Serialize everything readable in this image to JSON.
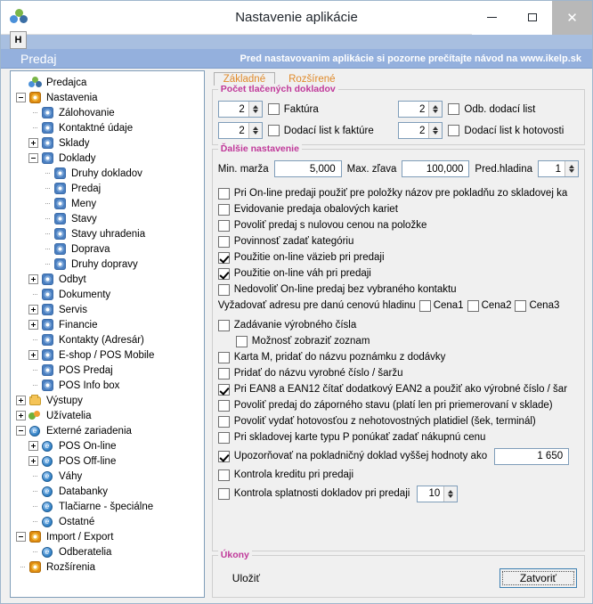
{
  "window": {
    "title": "Nastavenie aplikácie",
    "icon": "app-logo-icon",
    "minimize_label": "–",
    "maximize_label": "□",
    "close_label": "✕"
  },
  "menu": {
    "item_h": "H"
  },
  "banner": {
    "title": "Predaj",
    "note": "Pred nastavovanim aplikácie si pozorne prečítajte návod na www.ikelp.sk"
  },
  "tree": {
    "items": [
      {
        "label": "Predajca",
        "depth": 0,
        "expander": "none",
        "icon": "logo"
      },
      {
        "label": "Nastavenia",
        "depth": 0,
        "expander": "minus",
        "icon": "gear-orange"
      },
      {
        "label": "Zálohovanie",
        "depth": 1,
        "expander": "dots",
        "icon": "gear-blue"
      },
      {
        "label": "Kontaktné údaje",
        "depth": 1,
        "expander": "dots",
        "icon": "gear-blue"
      },
      {
        "label": "Sklady",
        "depth": 1,
        "expander": "plus",
        "icon": "gear-blue"
      },
      {
        "label": "Doklady",
        "depth": 1,
        "expander": "minus",
        "icon": "gear-blue"
      },
      {
        "label": "Druhy dokladov",
        "depth": 2,
        "expander": "dots",
        "icon": "gear-blue"
      },
      {
        "label": "Predaj",
        "depth": 2,
        "expander": "dots",
        "icon": "gear-blue"
      },
      {
        "label": "Meny",
        "depth": 2,
        "expander": "dots",
        "icon": "gear-blue"
      },
      {
        "label": "Stavy",
        "depth": 2,
        "expander": "dots",
        "icon": "gear-blue"
      },
      {
        "label": "Stavy uhradenia",
        "depth": 2,
        "expander": "dots",
        "icon": "gear-blue"
      },
      {
        "label": "Doprava",
        "depth": 2,
        "expander": "dots",
        "icon": "gear-blue"
      },
      {
        "label": "Druhy dopravy",
        "depth": 2,
        "expander": "dots",
        "icon": "gear-blue"
      },
      {
        "label": "Odbyt",
        "depth": 1,
        "expander": "plus",
        "icon": "gear-blue"
      },
      {
        "label": "Dokumenty",
        "depth": 1,
        "expander": "dots",
        "icon": "gear-blue"
      },
      {
        "label": "Servis",
        "depth": 1,
        "expander": "plus",
        "icon": "gear-blue"
      },
      {
        "label": "Financie",
        "depth": 1,
        "expander": "plus",
        "icon": "gear-blue"
      },
      {
        "label": "Kontakty (Adresár)",
        "depth": 1,
        "expander": "dots",
        "icon": "gear-blue"
      },
      {
        "label": "E-shop / POS Mobile",
        "depth": 1,
        "expander": "plus",
        "icon": "gear-blue"
      },
      {
        "label": "POS Predaj",
        "depth": 1,
        "expander": "dots",
        "icon": "gear-blue"
      },
      {
        "label": "POS Info box",
        "depth": 1,
        "expander": "dots",
        "icon": "gear-blue"
      },
      {
        "label": "Výstupy",
        "depth": 0,
        "expander": "plus",
        "icon": "folder"
      },
      {
        "label": "Užívatelia",
        "depth": 0,
        "expander": "plus",
        "icon": "users"
      },
      {
        "label": "Externé zariadenia",
        "depth": 0,
        "expander": "minus",
        "icon": "circle-e"
      },
      {
        "label": "POS On-line",
        "depth": 1,
        "expander": "plus",
        "icon": "circle-e"
      },
      {
        "label": "POS Off-line",
        "depth": 1,
        "expander": "plus",
        "icon": "circle-e"
      },
      {
        "label": "Váhy",
        "depth": 1,
        "expander": "dots",
        "icon": "circle-e"
      },
      {
        "label": "Databanky",
        "depth": 1,
        "expander": "dots",
        "icon": "circle-e"
      },
      {
        "label": "Tlačiarne - špeciálne",
        "depth": 1,
        "expander": "dots",
        "icon": "circle-e"
      },
      {
        "label": "Ostatné",
        "depth": 1,
        "expander": "dots",
        "icon": "circle-e"
      },
      {
        "label": "Import / Export",
        "depth": 0,
        "expander": "minus",
        "icon": "gear-orange"
      },
      {
        "label": "Odberatelia",
        "depth": 1,
        "expander": "dots",
        "icon": "circle-e"
      },
      {
        "label": "Rozšírenia",
        "depth": 0,
        "expander": "dots",
        "icon": "gear-orange"
      }
    ]
  },
  "tabs": [
    {
      "label": "Základné",
      "active": true
    },
    {
      "label": "Rozšírené",
      "active": false
    }
  ],
  "print_group": {
    "title": "Počet tlačených dokladov",
    "fields": [
      {
        "value": "2",
        "label": "Faktúra",
        "checked": false
      },
      {
        "value": "2",
        "label": "Odb. dodací list",
        "checked": false
      },
      {
        "value": "2",
        "label": "Dodací list k faktúre",
        "checked": false
      },
      {
        "value": "2",
        "label": "Dodací list k hotovosti",
        "checked": false
      }
    ]
  },
  "other_group": {
    "title": "Ďalšie nastavenie",
    "min_margin_label": "Min. marža",
    "min_margin_value": "5,000",
    "max_discount_label": "Max. zľava",
    "max_discount_value": "100,000",
    "price_level_label": "Pred.hladina",
    "price_level_value": "1",
    "checkboxes": [
      {
        "label": "Pri On-line predaji použiť pre položky názov pre pokladňu zo skladovej ka",
        "checked": false,
        "sub": false
      },
      {
        "label": "Evidovanie predaja obalových kariet",
        "checked": false,
        "sub": false
      },
      {
        "label": "Povoliť predaj s nulovou cenou na položke",
        "checked": false,
        "sub": false
      },
      {
        "label": "Povinnosť zadať kategóriu",
        "checked": false,
        "sub": false
      },
      {
        "label": "Použitie on-line väzieb pri predaji",
        "checked": true,
        "sub": false
      },
      {
        "label": "Použitie on-line váh pri predaji",
        "checked": true,
        "sub": false
      },
      {
        "label": "Nedovoliť On-line predaj bez vybraného kontaktu",
        "checked": false,
        "sub": false
      }
    ],
    "price_level_row": {
      "label": "Vyžadovať adresu pre danú cenovú hladinu",
      "options": [
        {
          "label": "Cena1",
          "checked": false
        },
        {
          "label": "Cena2",
          "checked": false
        },
        {
          "label": "Cena3",
          "checked": false
        }
      ]
    },
    "checkboxes2": [
      {
        "label": "Zadávanie výrobného čísla",
        "checked": false,
        "sub": false
      },
      {
        "label": "Možnosť zobraziť zoznam",
        "checked": false,
        "sub": true
      },
      {
        "label": "Karta M, pridať do názvu poznámku z dodávky",
        "checked": false,
        "sub": false
      },
      {
        "label": "Pridať do názvu vyrobné číslo / šaržu",
        "checked": false,
        "sub": false
      },
      {
        "label": "Pri EAN8 a EAN12 čítať dodatkový EAN2 a použiť ako výrobné číslo / šar",
        "checked": true,
        "sub": false
      },
      {
        "label": "Povoliť predaj do záporného stavu (platí len pri priemerovaní v sklade)",
        "checked": false,
        "sub": false
      },
      {
        "label": "Povoliť vydať hotovosťou z nehotovostných platidiel (šek, terminál)",
        "checked": false,
        "sub": false
      },
      {
        "label": "Pri skladovej karte typu P ponúkať zadať nákupnú cenu",
        "checked": false,
        "sub": false
      }
    ],
    "warn_row": {
      "label": "Upozorňovať na pokladničný doklad vyššej hodnoty ako",
      "checked": true,
      "value": "1 650"
    },
    "credit_row": {
      "label": "Kontrola kreditu pri predaji",
      "checked": false
    },
    "maturity_row": {
      "label": "Kontrola splatnosti dokladov pri predaji",
      "checked": false,
      "value": "10"
    }
  },
  "actions": {
    "title": "Úkony",
    "save_label": "Uložiť",
    "close_label": "Zatvoriť"
  }
}
